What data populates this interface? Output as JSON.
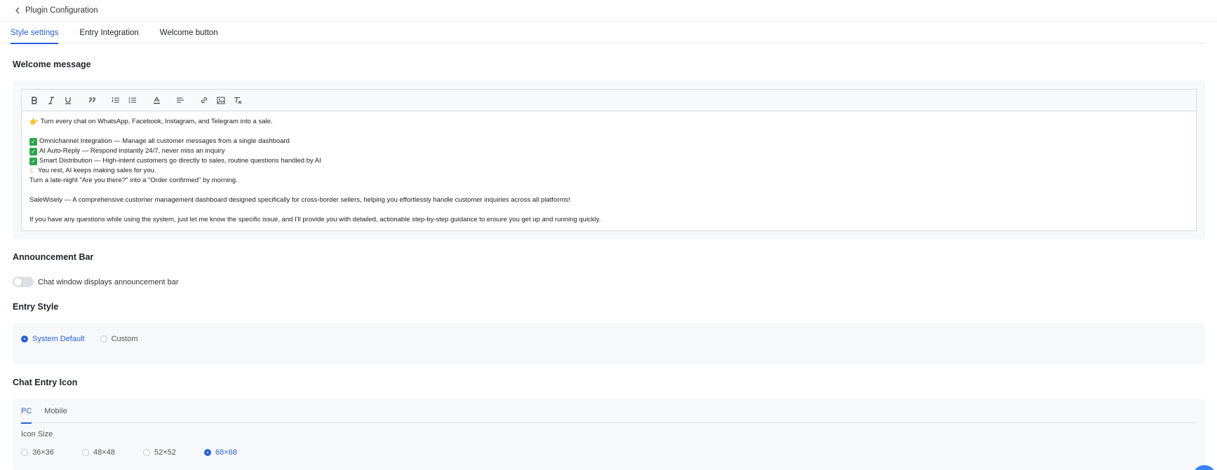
{
  "header": {
    "title": "Plugin Configuration",
    "back_icon": "chevron-left-icon"
  },
  "tabs": [
    {
      "label": "Style settings",
      "active": true
    },
    {
      "label": "Entry Integration",
      "active": false
    },
    {
      "label": "Welcome button",
      "active": false
    }
  ],
  "welcome": {
    "title": "Welcome message",
    "toolbar": [
      "bold-icon",
      "italic-icon",
      "underline-icon",
      "blockquote-icon",
      "ordered-list-icon",
      "bullet-list-icon",
      "text-color-icon",
      "align-icon",
      "link-icon",
      "image-icon",
      "clear-format-icon"
    ],
    "lines": [
      "Turn every chat on WhatsApp, Facebook, Instagram, and Telegram into a sale.",
      "",
      "Omnichannel Integration — Manage all customer messages from a single dashboard",
      "AI Auto-Reply — Respond instantly 24/7, never miss an inquiry",
      "Smart Distribution — High-intent customers go directly to sales, routine questions handled by AI",
      "You rest, AI keeps making sales for you.",
      "Turn a late-night \"Are you there?\" into a \"Order confirmed\" by morning.",
      "",
      "SaleWisely — A comprehensive customer management dashboard designed specifically for cross-border sellers, helping you effortlessly handle customer inquiries across all platforms!",
      "",
      "If you have any questions while using the system, just let me know the specific issue, and I'll provide you with detailed, actionable step-by-step guidance to ensure you get up and running quickly."
    ]
  },
  "announcement": {
    "title": "Announcement Bar",
    "toggle_label": "Chat window displays announcement bar",
    "enabled": false
  },
  "entry_style": {
    "title": "Entry Style",
    "options": [
      {
        "label": "System Default",
        "checked": true
      },
      {
        "label": "Custom",
        "checked": false
      }
    ]
  },
  "chat_icon": {
    "title": "Chat Entry Icon",
    "tabs": [
      {
        "label": "PC",
        "active": true
      },
      {
        "label": "Mobile",
        "active": false
      }
    ],
    "size_label": "Icon Size",
    "sizes": [
      {
        "label": "36×36",
        "checked": false
      },
      {
        "label": "48×48",
        "checked": false
      },
      {
        "label": "52×52",
        "checked": false
      },
      {
        "label": "68×68",
        "checked": true
      }
    ]
  },
  "colors": {
    "accent": "#2a62d6",
    "panel_bg": "#f7f8fa"
  }
}
